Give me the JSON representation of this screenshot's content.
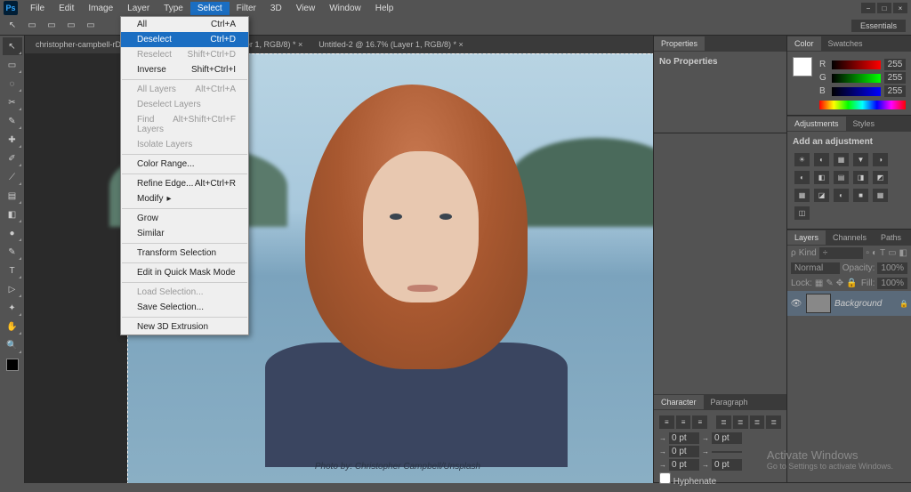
{
  "menubar": [
    "File",
    "Edit",
    "Image",
    "Layer",
    "Type",
    "Select",
    "Filter",
    "3D",
    "View",
    "Window",
    "Help"
  ],
  "active_menu_index": 5,
  "workspace": "Essentials",
  "tabs": [
    "christopher-campbell-rDEOVtE7vO…",
    "… @ 25% (Layer 1, RGB/8) *",
    "Untitled-2 @ 16.7% (Layer 1, RGB/8) *"
  ],
  "dropdown": [
    {
      "label": "All",
      "shortcut": "Ctrl+A"
    },
    {
      "label": "Deselect",
      "shortcut": "Ctrl+D",
      "highlight": true
    },
    {
      "label": "Reselect",
      "shortcut": "Shift+Ctrl+D",
      "disabled": true
    },
    {
      "label": "Inverse",
      "shortcut": "Shift+Ctrl+I"
    },
    {
      "sep": true
    },
    {
      "label": "All Layers",
      "shortcut": "Alt+Ctrl+A",
      "disabled": true
    },
    {
      "label": "Deselect Layers",
      "disabled": true
    },
    {
      "label": "Find Layers",
      "shortcut": "Alt+Shift+Ctrl+F",
      "disabled": true
    },
    {
      "label": "Isolate Layers",
      "disabled": true
    },
    {
      "sep": true
    },
    {
      "label": "Color Range..."
    },
    {
      "sep": true
    },
    {
      "label": "Refine Edge...",
      "shortcut": "Alt+Ctrl+R"
    },
    {
      "label": "Modify",
      "submenu": true
    },
    {
      "sep": true
    },
    {
      "label": "Grow"
    },
    {
      "label": "Similar"
    },
    {
      "sep": true
    },
    {
      "label": "Transform Selection"
    },
    {
      "sep": true
    },
    {
      "label": "Edit in Quick Mask Mode"
    },
    {
      "sep": true
    },
    {
      "label": "Load Selection...",
      "disabled": true
    },
    {
      "label": "Save Selection..."
    },
    {
      "sep": true
    },
    {
      "label": "New 3D Extrusion"
    }
  ],
  "photo_credit": "Photo by: Christopher Campbell/Unsplash",
  "properties": {
    "tab": "Properties",
    "text": "No Properties"
  },
  "color": {
    "tabs": [
      "Color",
      "Swatches"
    ],
    "r": "255",
    "g": "255",
    "b": "255"
  },
  "adjustments": {
    "tabs": [
      "Adjustments",
      "Styles"
    ],
    "title": "Add an adjustment"
  },
  "layers": {
    "tabs": [
      "Layers",
      "Channels",
      "Paths"
    ],
    "kind_label": "Kind",
    "mode": "Normal",
    "opacity_label": "Opacity:",
    "opacity": "100%",
    "lock_label": "Lock:",
    "fill_label": "Fill:",
    "fill": "100%",
    "layer_name": "Background"
  },
  "character": {
    "tabs": [
      "Character",
      "Paragraph"
    ],
    "rows": [
      [
        "0 pt",
        "0 pt"
      ],
      [
        "0 pt",
        ""
      ],
      [
        "0 pt",
        "0 pt"
      ]
    ],
    "hyphenate": "Hyphenate"
  },
  "activate": {
    "title": "Activate Windows",
    "sub": "Go to Settings to activate Windows."
  },
  "tool_icons": [
    "↖",
    "▭",
    "◌",
    "✂",
    "✎",
    "✚",
    "✐",
    "⟋",
    "▤",
    "◧",
    "●",
    "✎",
    "T",
    "▷",
    "✦",
    "✋",
    "🔍"
  ],
  "adj_icons": [
    "☀",
    "◐",
    "▦",
    "▼",
    "◑",
    "◐",
    "◧",
    "▤",
    "◨",
    "◩",
    "▦",
    "◪",
    "◐",
    "■",
    "▦",
    "◫"
  ]
}
